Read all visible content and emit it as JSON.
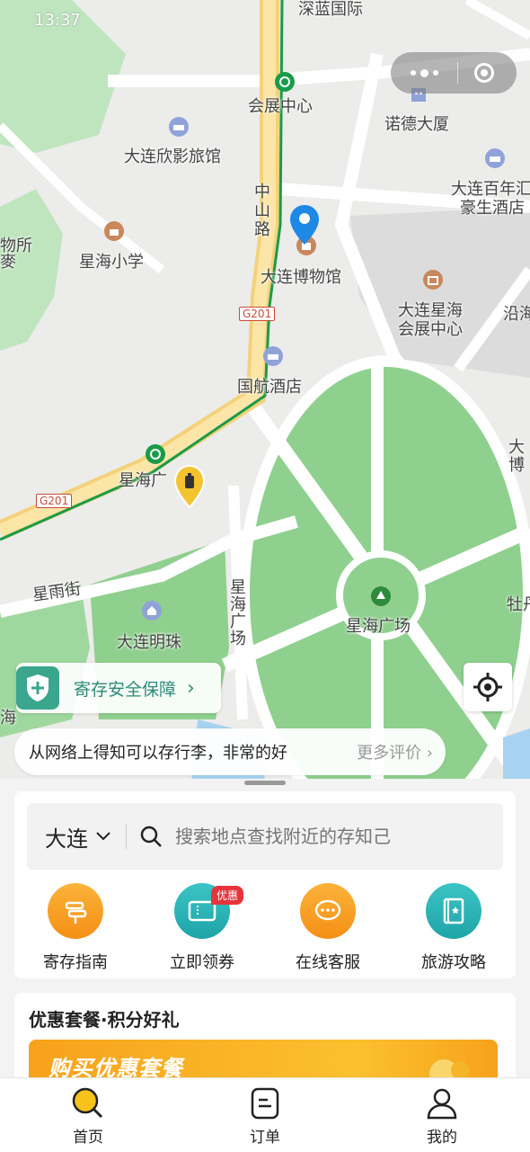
{
  "status_bar": {
    "time": "13:37"
  },
  "map": {
    "labels": {
      "shenlan": "深蓝国际",
      "expo_center": "会展中心",
      "nuode": "诺德大厦",
      "xinying_hotel": "大连欣影旅馆",
      "bainian_line1": "大连百年汇",
      "bainian_line2": "豪生酒店",
      "zhongshan_road": "中山路",
      "xinghai_school": "星海小学",
      "museum": "大连博物馆",
      "xinghai_expo_line1": "大连星海",
      "xinghai_expo_line2": "会展中心",
      "yan": "沿海",
      "guohang_hotel": "国航酒店",
      "xinghai_station": "星海广",
      "da_bo": "大\n博",
      "xingyu_street": "星雨街",
      "xinghai_plaza_road": "星海广场",
      "xinghai_plaza": "星海广场",
      "mudan": "牡丹",
      "dalian_mingzhu": "大连明珠",
      "wusuo": "物所\n麥",
      "hai": "海"
    },
    "road_badges": [
      "G201",
      "G201"
    ]
  },
  "safety_chip": {
    "label": "寄存安全保障"
  },
  "review": {
    "text": "从网络上得知可以存行李，非常的好",
    "more": "更多评价"
  },
  "search": {
    "city": "大连",
    "placeholder": "搜索地点查找附近的存知己"
  },
  "quick_actions": [
    {
      "label": "寄存指南",
      "icon": "signpost-icon",
      "color": "#f7a21b"
    },
    {
      "label": "立即领券",
      "icon": "ticket-icon",
      "color": "#2bb3b6",
      "badge": "优惠"
    },
    {
      "label": "在线客服",
      "icon": "chat-icon",
      "color": "#f7a21b"
    },
    {
      "label": "旅游攻略",
      "icon": "guidebook-icon",
      "color": "#2bb3b6"
    }
  ],
  "promo": {
    "title": "优惠套餐·积分好礼",
    "banner_text": "购买优惠套餐"
  },
  "tabs": [
    {
      "label": "首页",
      "icon": "home-search-icon",
      "active": true
    },
    {
      "label": "订单",
      "icon": "order-icon",
      "active": false
    },
    {
      "label": "我的",
      "icon": "profile-icon",
      "active": false
    }
  ],
  "colors": {
    "accent": "#f7a21b",
    "teal": "#2c8a76",
    "map_green": "#8fd08f",
    "pin_blue": "#1e88e5"
  }
}
